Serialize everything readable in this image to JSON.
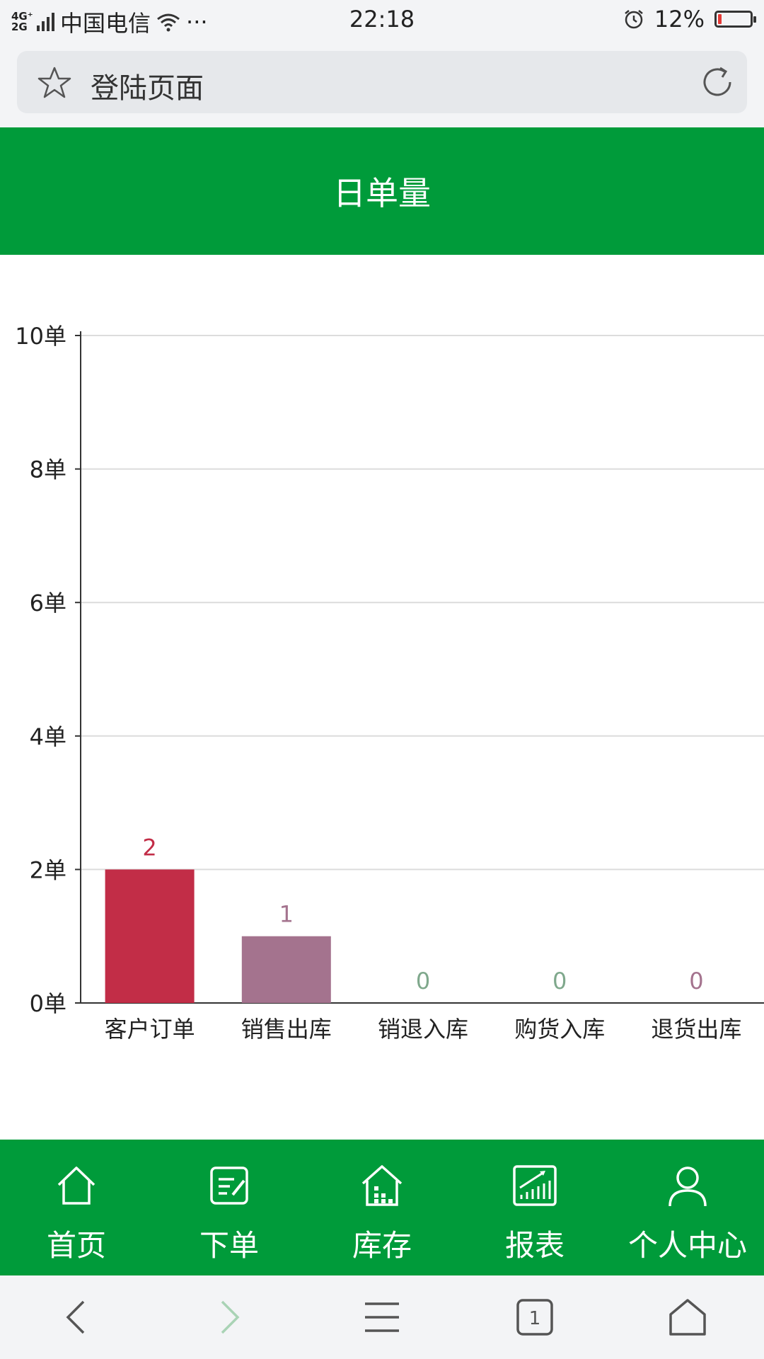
{
  "status_bar": {
    "network": "4G⁺\n2G",
    "carrier": "中国电信",
    "more": "···",
    "time": "22:18",
    "battery_text": "12%",
    "battery_level": 0.12
  },
  "address_bar": {
    "title": "登陆页面"
  },
  "header": {
    "title": "日单量"
  },
  "chart_data": {
    "type": "bar",
    "categories": [
      "客户订单",
      "销售出库",
      "销退入库",
      "购货入库",
      "退货出库"
    ],
    "values": [
      2,
      1,
      0,
      0,
      0
    ],
    "colors": [
      "#c22d47",
      "#a4738e",
      "#7fa88c",
      "#7fa88c",
      "#a4738e"
    ],
    "y_ticks": [
      "0单",
      "2单",
      "4单",
      "6单",
      "8单",
      "10单"
    ],
    "ylim": [
      0,
      10
    ],
    "grid": true
  },
  "tabbar": {
    "items": [
      {
        "label": "首页",
        "icon": "home-icon"
      },
      {
        "label": "下单",
        "icon": "edit-order-icon"
      },
      {
        "label": "库存",
        "icon": "warehouse-icon"
      },
      {
        "label": "报表",
        "icon": "report-chart-icon"
      },
      {
        "label": "个人中心",
        "icon": "user-icon"
      }
    ]
  },
  "browser_nav": {
    "tab_count": "1"
  }
}
